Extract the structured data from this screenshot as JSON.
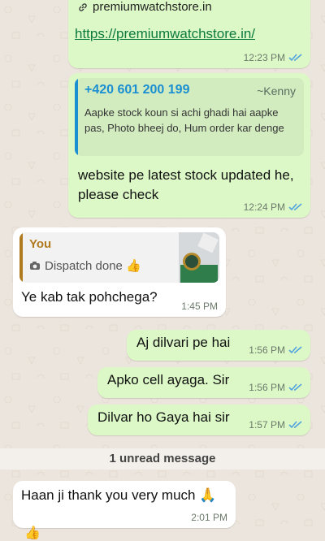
{
  "colors": {
    "outgoing_bubble": "#dcf8c6",
    "incoming_bubble": "#ffffff",
    "read_ticks": "#4fa3e0",
    "link": "#0b7a3e",
    "quote_phone": "#1a8fd1",
    "quote_you": "#b07a1e"
  },
  "messages": [
    {
      "id": "m1",
      "type": "link",
      "link_host": "premiumwatchstore.in",
      "link_url": "https://premiumwatchstore.in/",
      "time": "12:23 PM",
      "read": true
    },
    {
      "id": "m2",
      "type": "reply",
      "quote_phone": "+420 601 200 199",
      "quote_name": "~Kenny",
      "quote_text": "Aapke stock koun si achi ghadi hai aapke pas, Photo bheej do, Hum order kar denge",
      "text": "website pe latest stock updated he, please check",
      "time": "12:24 PM",
      "read": true
    },
    {
      "id": "m3",
      "type": "reply_in",
      "quote_author": "You",
      "quote_text": "Dispatch done 👍",
      "text": "Ye kab tak pohchega?",
      "time": "1:45 PM"
    },
    {
      "id": "m4",
      "type": "text",
      "text": "Aj dilvari pe hai",
      "time": "1:56 PM",
      "read": true
    },
    {
      "id": "m5",
      "type": "text",
      "text": "Apko cell ayaga. Sir",
      "time": "1:56 PM",
      "read": true
    },
    {
      "id": "m6",
      "type": "text",
      "text": "Dilvar ho Gaya hai sir",
      "time": "1:57 PM",
      "read": true
    }
  ],
  "unread_label": "1 unread message",
  "last_message": {
    "text": "Haan ji thank you very much 🙏",
    "time": "2:01 PM"
  },
  "bottom_emoji": "👍",
  "icons": [
    "link-icon",
    "camera-icon",
    "double-check-icon",
    "watch-thumbnail"
  ]
}
